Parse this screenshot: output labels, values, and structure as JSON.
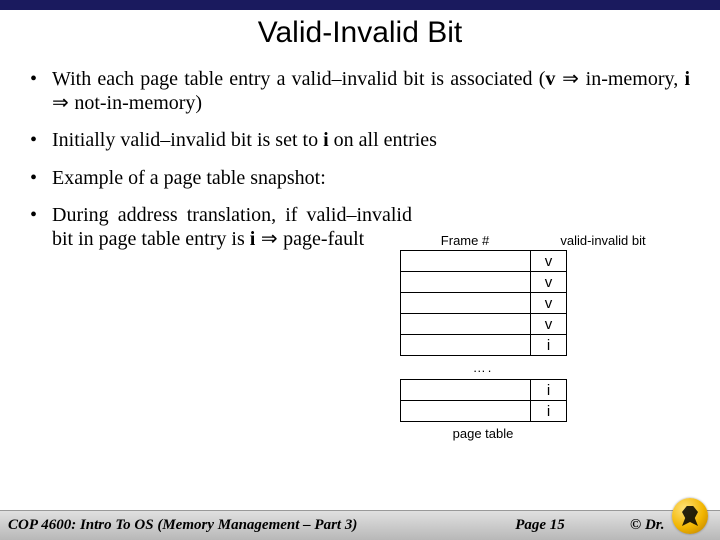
{
  "title": "Valid-Invalid Bit",
  "bullets": {
    "b1_pre": "With each page table entry a valid–invalid bit is associated (",
    "b1_v": "v",
    "b1_imp1": " ⇒ ",
    "b1_mid": "in-memory, ",
    "b1_i": "i",
    "b1_imp2": " ⇒ ",
    "b1_post": "not-in-memory)",
    "b2_pre": "Initially valid–invalid bit is set to ",
    "b2_i": "i",
    "b2_post": " on all entries",
    "b3": "Example of a page table snapshot:",
    "b4_pre": "During address translation, if valid–invalid bit in page table entry is ",
    "b4_i": "i",
    "b4_imp": " ⇒ ",
    "b4_post": "page-fault"
  },
  "table": {
    "hdr_frame": "Frame #",
    "hdr_valid": "valid-invalid bit",
    "rows1": [
      "v",
      "v",
      "v",
      "v",
      "i"
    ],
    "ellipsis": "….",
    "rows2": [
      "i",
      "i"
    ],
    "caption": "page table"
  },
  "footer": {
    "left": "COP 4600: Intro To OS  (Memory Management – Part 3)",
    "center": "Page 15",
    "right": "© Dr."
  }
}
